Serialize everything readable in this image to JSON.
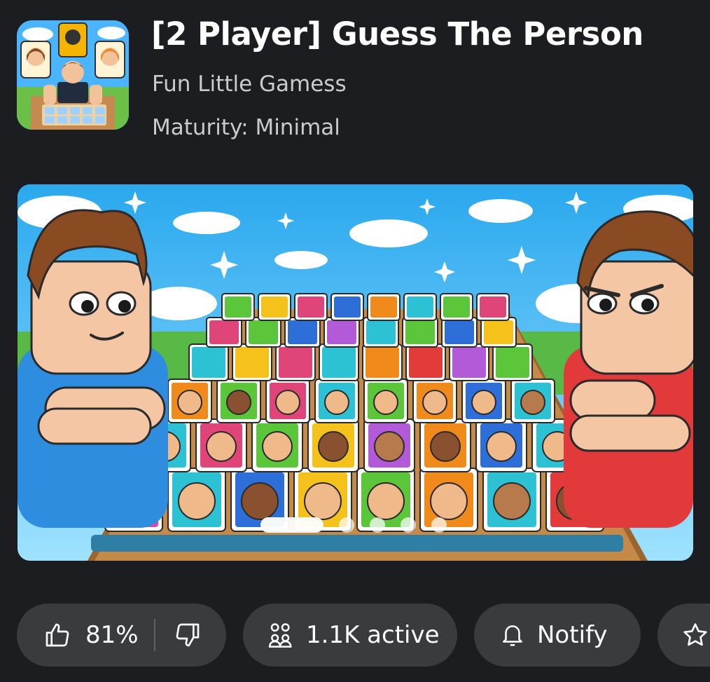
{
  "game": {
    "title": "[2 Player] Guess The Person",
    "creator": "Fun Little Gamess",
    "maturity": "Maturity: Minimal"
  },
  "icons": {
    "thumbs_up": "thumbs-up-icon",
    "thumbs_down": "thumbs-down-icon",
    "players": "players-icon",
    "bell": "bell-icon",
    "star": "star-icon"
  },
  "carousel": {
    "slide_count": 5,
    "active_index": 0
  },
  "actions": {
    "vote": {
      "like_percent": "81%"
    },
    "active": {
      "label": "1.1K active"
    },
    "notify": {
      "label": "Notify"
    }
  },
  "colors": {
    "background": "#1c1d21",
    "pill": "#393b3d",
    "text_secondary": "#c9cbcf"
  }
}
